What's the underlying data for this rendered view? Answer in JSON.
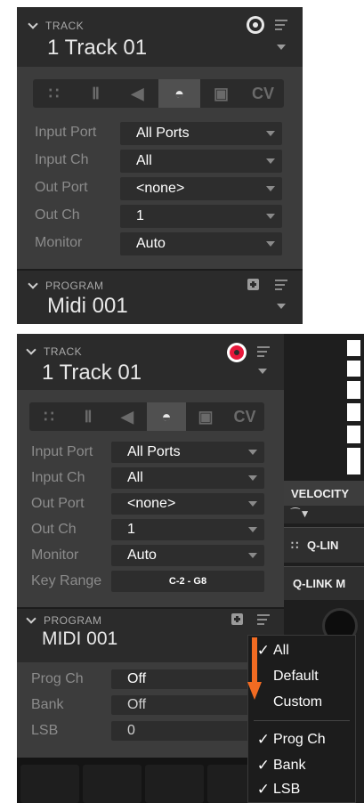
{
  "panel1": {
    "track_header": "TRACK",
    "track_name": "1 Track 01",
    "tabs": [
      "∷",
      "Ⅱ",
      "◀",
      "◓",
      "▣",
      "CV"
    ],
    "rows": [
      {
        "label": "Input Port",
        "value": "All Ports"
      },
      {
        "label": "Input Ch",
        "value": "All"
      },
      {
        "label": "Out Port",
        "value": "<none>"
      },
      {
        "label": "Out Ch",
        "value": "1"
      },
      {
        "label": "Monitor",
        "value": "Auto"
      }
    ],
    "program_header": "PROGRAM",
    "program_name": "Midi 001"
  },
  "panel2": {
    "track_header": "TRACK",
    "track_name": "1 Track 01",
    "tabs": [
      "∷",
      "Ⅱ",
      "◀",
      "◓",
      "▣",
      "CV"
    ],
    "rows": [
      {
        "label": "Input Port",
        "value": "All Ports"
      },
      {
        "label": "Input Ch",
        "value": "All"
      },
      {
        "label": "Out Port",
        "value": "<none>"
      },
      {
        "label": "Out Ch",
        "value": "1"
      },
      {
        "label": "Monitor",
        "value": "Auto"
      },
      {
        "label": "Key Range",
        "value": "C-2 - G8"
      }
    ],
    "program_header": "PROGRAM",
    "program_name": "MIDI 001",
    "program_rows": [
      {
        "label": "Prog Ch",
        "value": "Off"
      },
      {
        "label": "Bank",
        "value": "Off"
      },
      {
        "label": "LSB",
        "value": "0"
      }
    ]
  },
  "background": {
    "velocity_label": "VELOCITY",
    "qlink_tab_label": "Q-LIN",
    "qlink_mode_label": "Q-LINK M"
  },
  "dropdown": {
    "items": [
      {
        "label": "All",
        "checked": true
      },
      {
        "label": "Default",
        "checked": false
      },
      {
        "label": "Custom",
        "checked": false
      },
      {
        "label": "Prog Ch",
        "checked": true
      },
      {
        "label": "Bank",
        "checked": true
      },
      {
        "label": "LSB",
        "checked": true
      }
    ]
  },
  "colors": {
    "record_active": "#e8183b",
    "arrow": "#f26b22",
    "panel_bg": "#3c3c3c",
    "header_bg": "#2b2b2b"
  },
  "icons": {
    "collapse": "chevron-down-icon",
    "menu": "hamburger-menu-icon",
    "record": "record-icon",
    "add": "plus-icon",
    "check": "checkmark-icon",
    "arrow": "arrow-down-icon"
  }
}
